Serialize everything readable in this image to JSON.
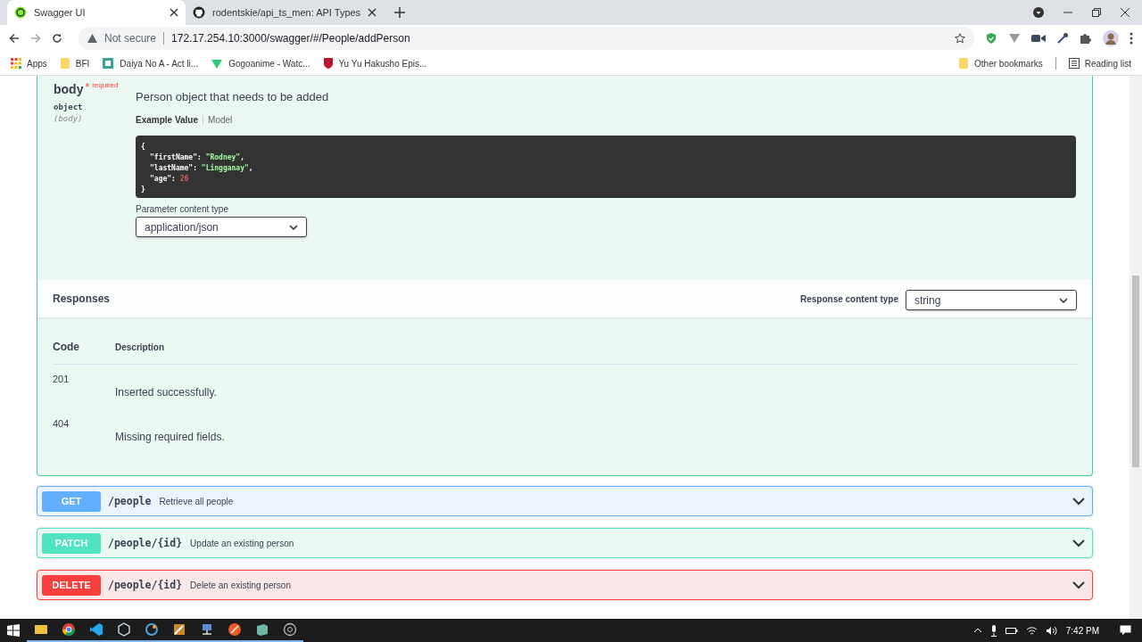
{
  "browser": {
    "tabs": [
      {
        "title": "Swagger UI",
        "selected": true
      },
      {
        "title": "rodentskie/api_ts_men: API Types",
        "selected": false
      }
    ],
    "security": "Not secure",
    "url": "172.17.254.10:3000/swagger/#/People/addPerson",
    "bookmarks": [
      "Apps",
      "BFI",
      "Daiya No A - Act li...",
      "Gogoanime - Watc...",
      "Yu Yu Hakusho Epis..."
    ],
    "other_bookmarks": "Other bookmarks",
    "reading_list": "Reading list"
  },
  "parameter": {
    "name": "body",
    "required_mark": "*",
    "required": "required",
    "type": "object",
    "in": "(body)",
    "description": "Person object that needs to be added",
    "example_tabs": [
      {
        "label": "Example Value",
        "selected": true
      },
      {
        "label": "Model",
        "selected": false
      }
    ],
    "example": [
      [
        {
          "text": "{",
          "kind": "punct"
        }
      ],
      [
        {
          "text": "\"firstName\"",
          "kind": "key"
        },
        {
          "text": ": ",
          "kind": "punct"
        },
        {
          "text": "\"Rodney\"",
          "kind": "string"
        },
        {
          "text": ",",
          "kind": "punct"
        }
      ],
      [
        {
          "text": "\"lastName\"",
          "kind": "key"
        },
        {
          "text": ": ",
          "kind": "punct"
        },
        {
          "text": "\"Lingganay\"",
          "kind": "string"
        },
        {
          "text": ",",
          "kind": "punct"
        }
      ],
      [
        {
          "text": "\"age\"",
          "kind": "key"
        },
        {
          "text": ": ",
          "kind": "punct"
        },
        {
          "text": "26",
          "kind": "number"
        }
      ],
      [
        {
          "text": "}",
          "kind": "punct"
        }
      ]
    ],
    "content_type_label": "Parameter content type",
    "content_type": "application/json"
  },
  "responses": {
    "title": "Responses",
    "content_type_label": "Response content type",
    "content_type": "string",
    "columns": [
      "Code",
      "Description"
    ],
    "rows": [
      {
        "code": "201",
        "description": "Inserted successfully."
      },
      {
        "code": "404",
        "description": "Missing required fields."
      }
    ]
  },
  "operations": [
    {
      "method": "GET",
      "kind": "get",
      "path": "/people",
      "summary": "Retrieve all people"
    },
    {
      "method": "PATCH",
      "kind": "patch",
      "path": "/people/{id}",
      "summary": "Update an existing person"
    },
    {
      "method": "DELETE",
      "kind": "delete",
      "path": "/people/{id}",
      "summary": "Delete an existing person"
    }
  ],
  "taskbar": {
    "time": "7:42 PM"
  }
}
